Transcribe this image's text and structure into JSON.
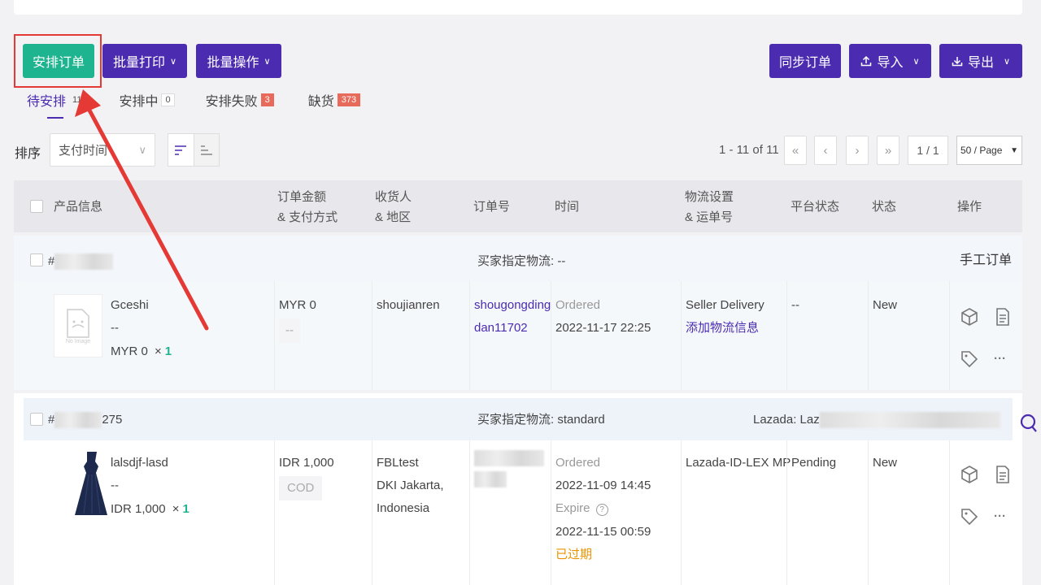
{
  "toolbar": {
    "arrange": "安排订单",
    "batch_print": "批量打印",
    "batch_ops": "批量操作",
    "sync": "同步订单",
    "import": "导入",
    "export": "导出"
  },
  "tabs": [
    {
      "label": "待安排",
      "count": "11"
    },
    {
      "label": "安排中",
      "count": "0"
    },
    {
      "label": "安排失败",
      "count": "3"
    },
    {
      "label": "缺货",
      "count": "373"
    }
  ],
  "sort": {
    "label": "排序",
    "value": "支付时间"
  },
  "pager": {
    "info": "1 - 11 of 11",
    "page": "1 / 1",
    "size": "50 / Page"
  },
  "columns": {
    "product": "产品信息",
    "amount_1": "订单金额",
    "amount_2": "& 支付方式",
    "recv_1": "收货人",
    "recv_2": "& 地区",
    "order_no": "订单号",
    "time": "时间",
    "logi_1": "物流设置",
    "logi_2": "& 运单号",
    "platform_status": "平台状态",
    "status": "状态",
    "ops": "操作"
  },
  "orders": [
    {
      "id_prefix": "#",
      "id_suffix": "",
      "buyer_logistics": "买家指定物流: --",
      "right_head": "手工订单",
      "product_name": "Gceshi",
      "product_sku": "--",
      "product_price": "MYR 0",
      "qty_x": "×",
      "qty": "1",
      "amount": "MYR 0",
      "pay_method": "--",
      "recipient": "shoujianren",
      "order_no_1": "shougongding",
      "order_no_2": "dan11702",
      "time_label": "Ordered",
      "time_value": "2022-11-17 22:25",
      "logistics": "Seller Delivery",
      "logistics_link": "添加物流信息",
      "platform_status": "--",
      "status": "New",
      "image_label": "No Image"
    },
    {
      "id_prefix": "#",
      "id_suffix": "275",
      "buyer_logistics": "买家指定物流: standard",
      "right_head": "Lazada: Laz",
      "product_name": "lalsdjf-lasd",
      "product_sku": "--",
      "product_price": "IDR 1,000",
      "qty_x": "×",
      "qty": "1",
      "amount": "IDR 1,000",
      "pay_method": "COD",
      "recipient_1": "FBLtest",
      "recipient_2": "DKI Jakarta,",
      "recipient_3": "Indonesia",
      "time_label": "Ordered",
      "time_value": "2022-11-09 14:45",
      "expire_label": "Expire",
      "expire_value": "2022-11-15 00:59",
      "expired": "已过期",
      "logistics": "Lazada-ID-LEX MP",
      "platform_status": "Pending",
      "status": "New"
    }
  ],
  "colors": {
    "accent": "#4b2bb0",
    "green": "#1db48f",
    "red": "#e53935"
  }
}
